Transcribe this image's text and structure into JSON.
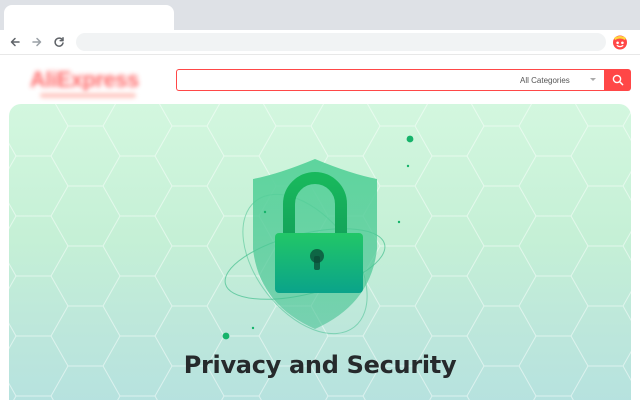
{
  "browser": {
    "icons": {
      "back": "back-arrow-icon",
      "forward": "forward-arrow-icon",
      "reload": "reload-icon",
      "extension": "aliexpress-extension-icon"
    }
  },
  "header": {
    "logo_text": "AliExpress",
    "search": {
      "value": "",
      "category_selected": "All Categories",
      "button_icon": "search-icon"
    }
  },
  "hero": {
    "title": "Privacy and Security",
    "illustration": "shield-padlock-icon"
  },
  "colors": {
    "brand_red": "#ff4747",
    "hero_green": "#c5f0d6",
    "padlock_green": "#1fc36a",
    "shield_green": "#4fd295"
  }
}
